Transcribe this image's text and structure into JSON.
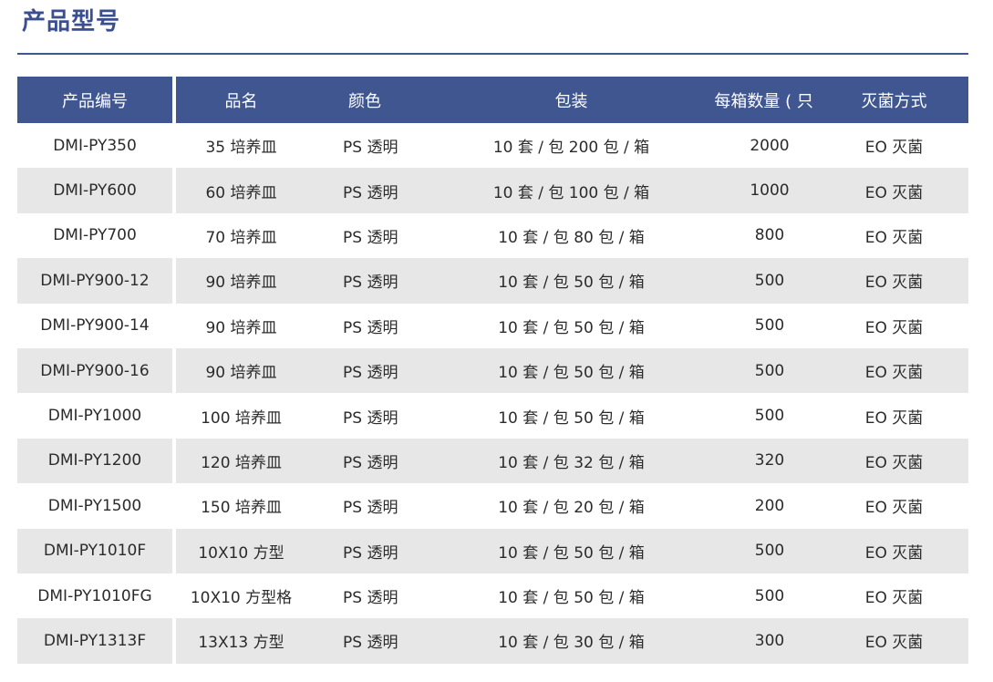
{
  "page": {
    "title": "产品型号"
  },
  "table": {
    "headers": [
      "产品编号",
      "品名",
      "颜色",
      "包装",
      "每箱数量 ( 只 )",
      "灭菌方式"
    ],
    "rows": [
      [
        "DMI-PY350",
        "35 培养皿",
        "PS 透明",
        "10 套 / 包 200 包 / 箱",
        "2000",
        "EO 灭菌"
      ],
      [
        "DMI-PY600",
        "60 培养皿",
        "PS 透明",
        "10 套 / 包 100 包 / 箱",
        "1000",
        "EO 灭菌"
      ],
      [
        "DMI-PY700",
        "70 培养皿",
        "PS 透明",
        "10 套 / 包 80 包 / 箱",
        "800",
        "EO 灭菌"
      ],
      [
        "DMI-PY900-12",
        "90 培养皿",
        "PS 透明",
        "10 套 / 包 50 包 / 箱",
        "500",
        "EO 灭菌"
      ],
      [
        "DMI-PY900-14",
        "90 培养皿",
        "PS 透明",
        "10 套 / 包 50 包 / 箱",
        "500",
        "EO 灭菌"
      ],
      [
        "DMI-PY900-16",
        "90 培养皿",
        "PS 透明",
        "10 套 / 包 50 包 / 箱",
        "500",
        "EO 灭菌"
      ],
      [
        "DMI-PY1000",
        "100 培养皿",
        "PS 透明",
        "10 套 / 包 50 包 / 箱",
        "500",
        "EO 灭菌"
      ],
      [
        "DMI-PY1200",
        "120 培养皿",
        "PS 透明",
        "10 套 / 包 32 包 / 箱",
        "320",
        "EO 灭菌"
      ],
      [
        "DMI-PY1500",
        "150 培养皿",
        "PS 透明",
        "10 套 / 包 20 包 / 箱",
        "200",
        "EO 灭菌"
      ],
      [
        "DMI-PY1010F",
        "10X10 方型",
        "PS 透明",
        "10 套 / 包 50 包 / 箱",
        "500",
        "EO 灭菌"
      ],
      [
        "DMI-PY1010FG",
        "10X10 方型格",
        "PS 透明",
        "10 套 / 包 50 包 / 箱",
        "500",
        "EO 灭菌"
      ],
      [
        "DMI-PY1313F",
        "13X13 方型",
        "PS 透明",
        "10 套 / 包 30 包 / 箱",
        "300",
        "EO 灭菌"
      ]
    ]
  },
  "colors": {
    "header_background": "#3f5690",
    "title_text": "#3b4f8f",
    "shaded_row": "#e7e7e7"
  }
}
